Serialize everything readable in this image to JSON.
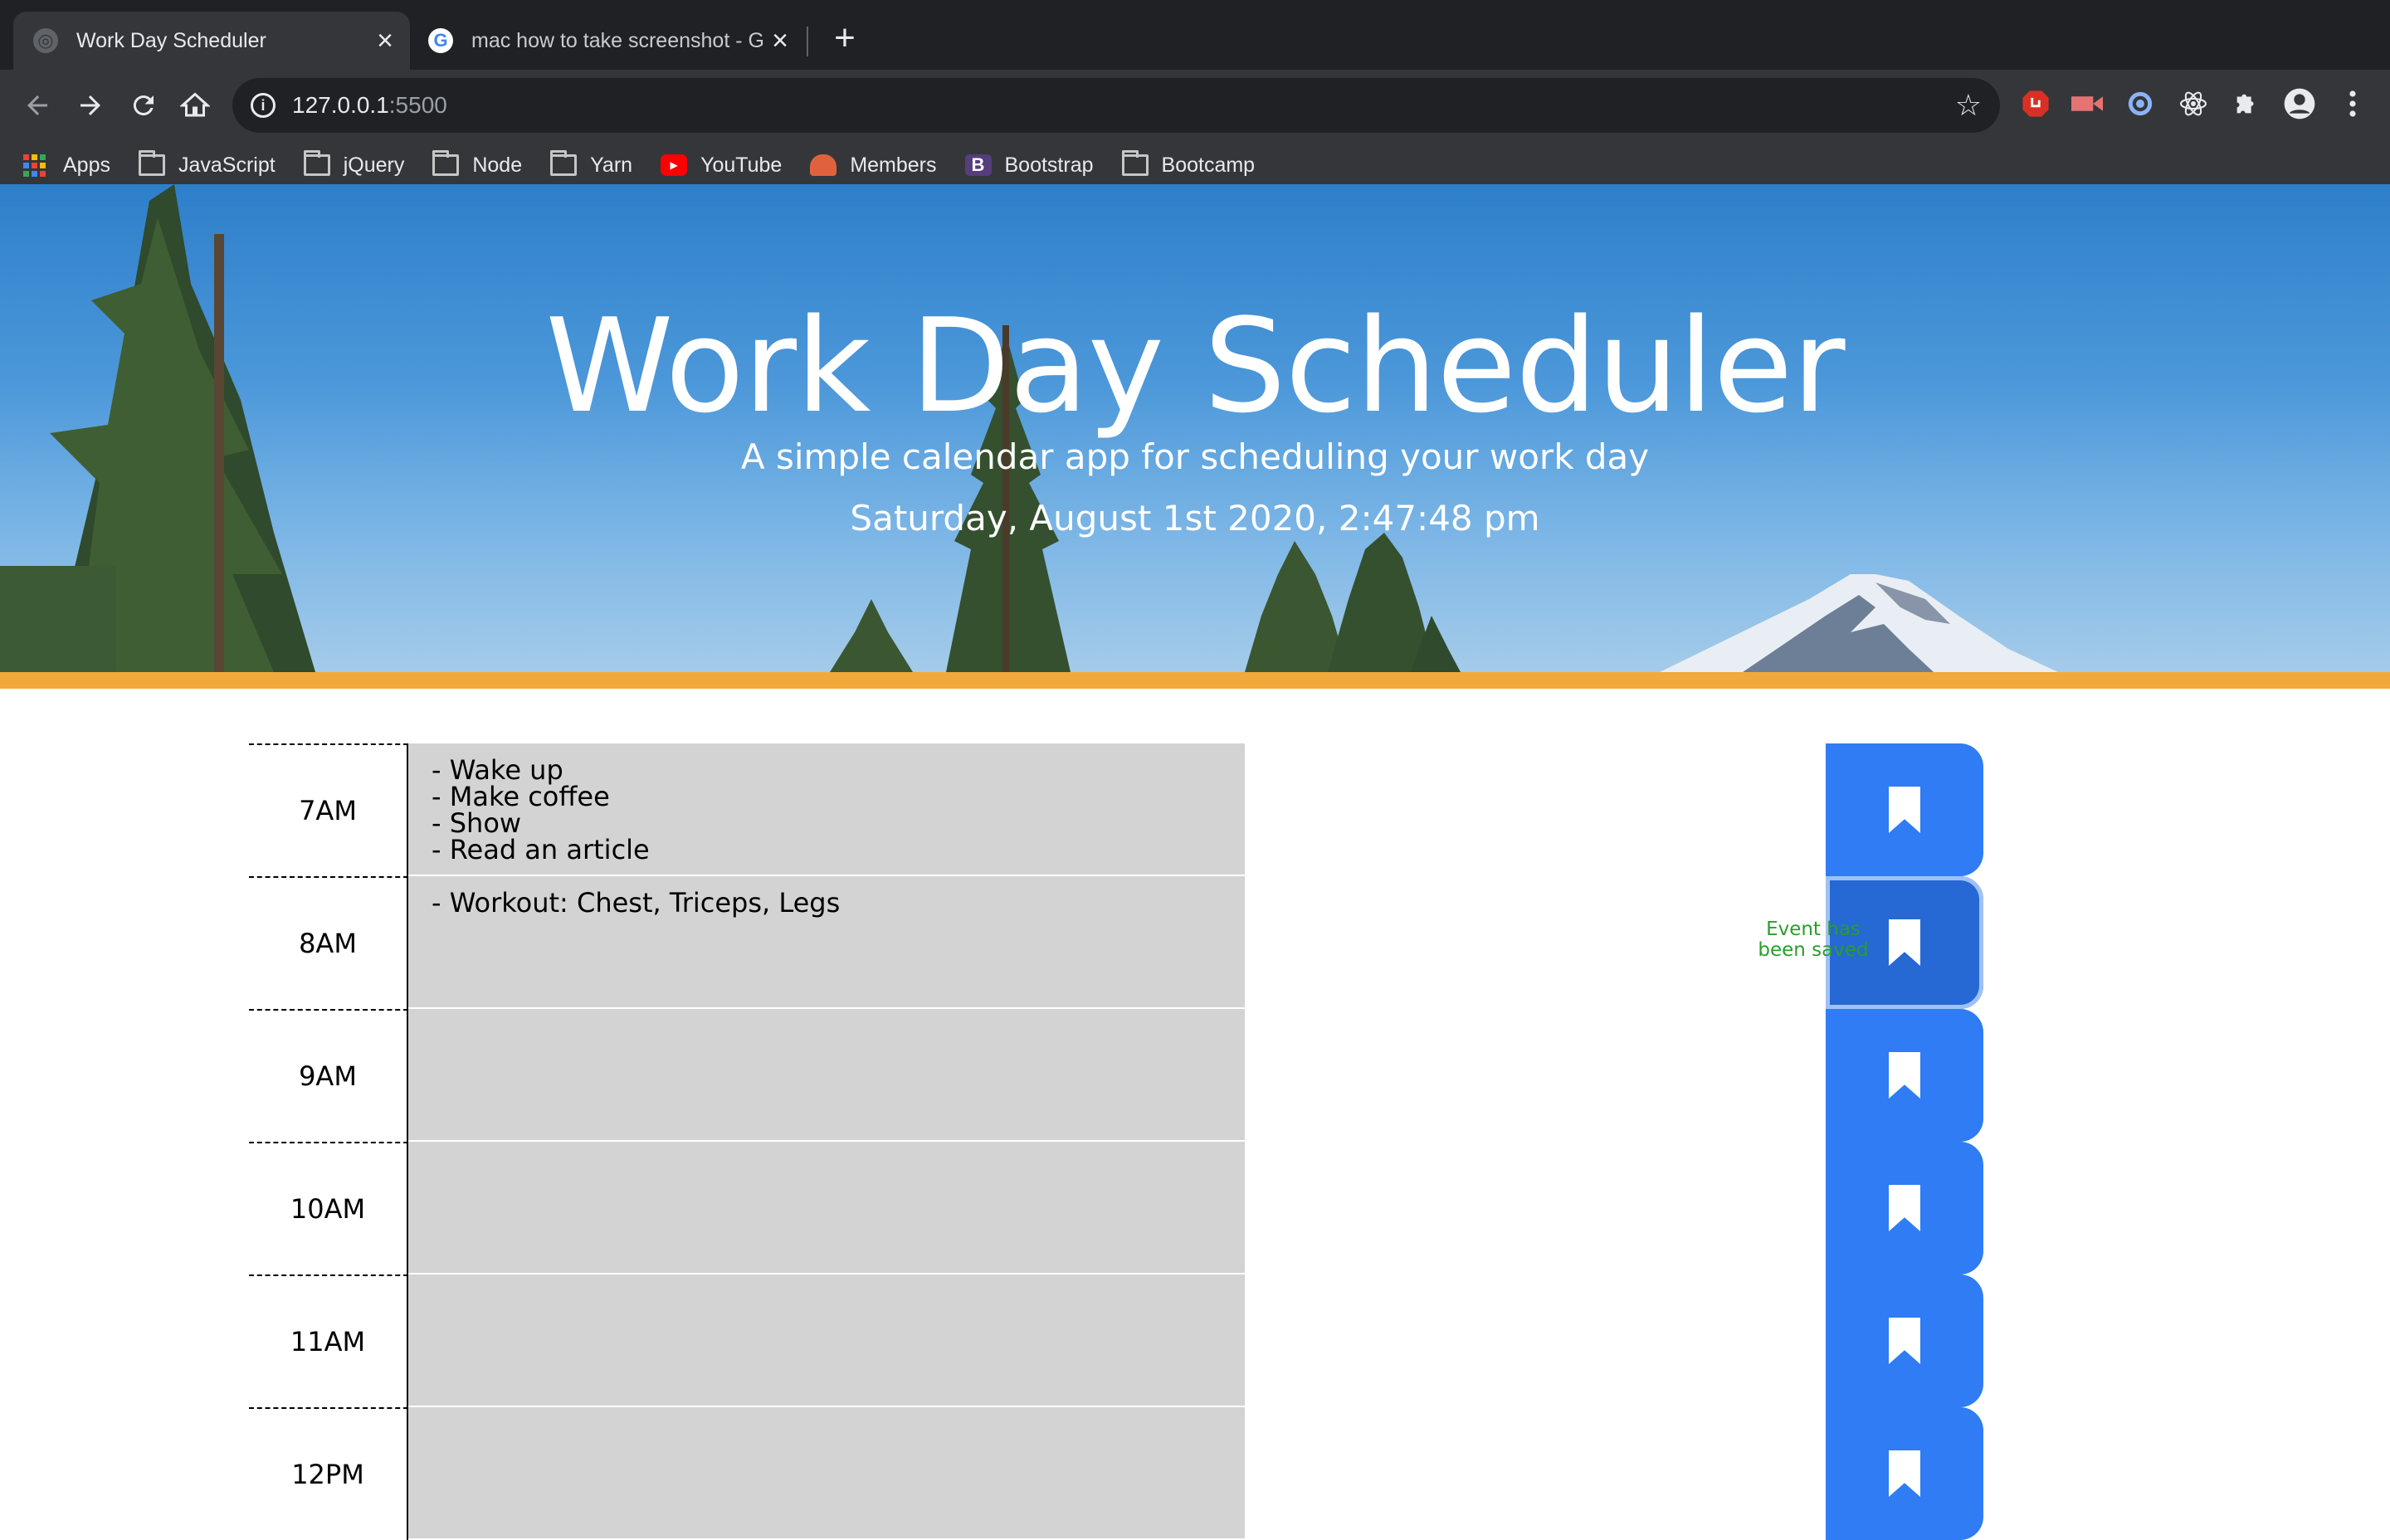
{
  "browser": {
    "tabs": [
      {
        "title": "Work Day Scheduler",
        "active": true
      },
      {
        "title": "mac how to take screenshot - Google Search",
        "active": false
      }
    ],
    "url_host": "127.0.0.1",
    "url_port": ":5500",
    "bookmarks": [
      "Apps",
      "JavaScript",
      "jQuery",
      "Node",
      "Yarn",
      "YouTube",
      "Members",
      "Bootstrap",
      "Bootcamp"
    ]
  },
  "header": {
    "title": "Work Day Scheduler",
    "subtitle": "A simple calendar app for scheduling your work day",
    "datetime": "Saturday, August 1st 2020, 2:47:48 pm"
  },
  "schedule": {
    "rows": [
      {
        "hour": "7AM",
        "lines": [
          "- Wake up",
          "- Make coffee",
          "- Show",
          "- Read an article"
        ]
      },
      {
        "hour": "8AM",
        "lines": [
          "- Workout: Chest, Triceps, Legs"
        ]
      },
      {
        "hour": "9AM",
        "lines": []
      },
      {
        "hour": "10AM",
        "lines": []
      },
      {
        "hour": "11AM",
        "lines": []
      },
      {
        "hour": "12PM",
        "lines": []
      }
    ],
    "saved_message": "Event has been saved"
  },
  "colors": {
    "accent_bar": "#f2a93b",
    "save_button": "#2f7cf4",
    "saved_text": "#2a9d2a",
    "row_bg": "#d3d3d3"
  }
}
